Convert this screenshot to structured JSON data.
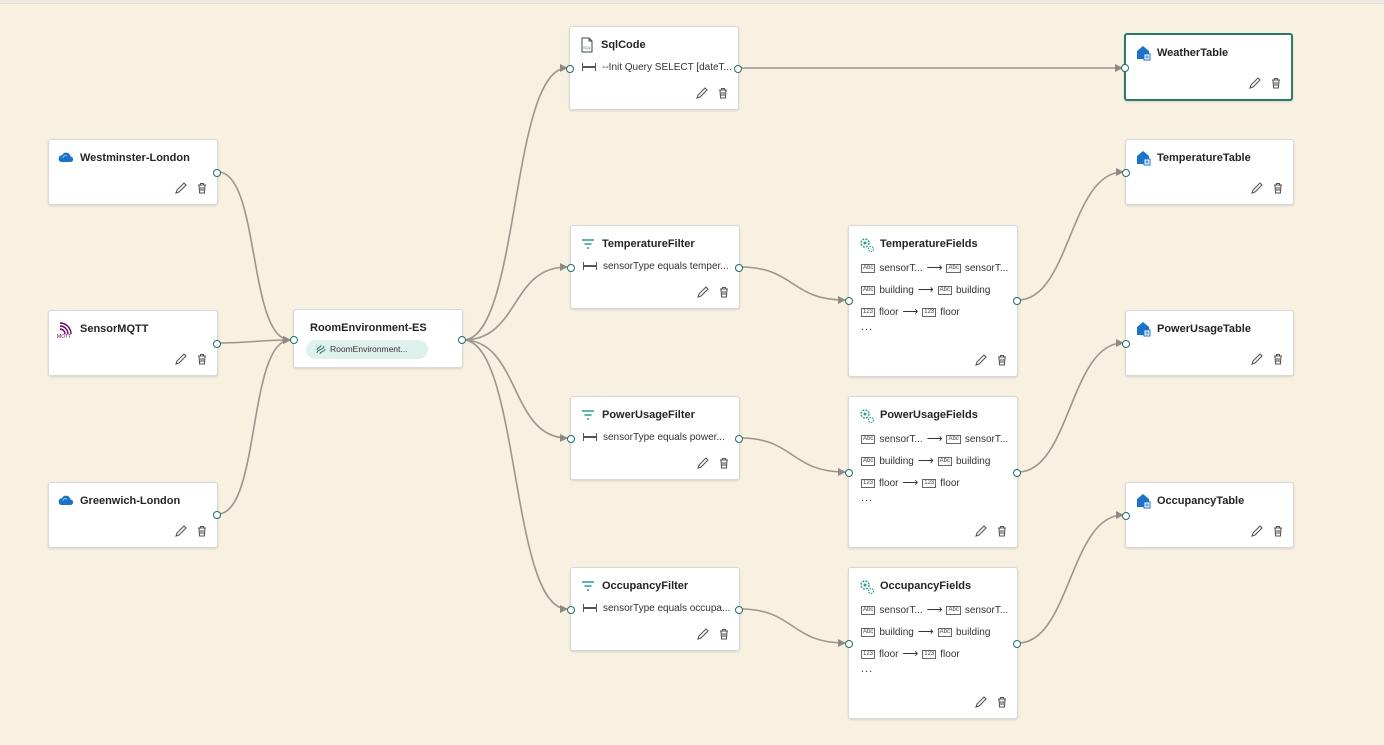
{
  "sources": [
    {
      "title": "Westminster-London",
      "icon": "weather-cloud-icon"
    },
    {
      "title": "SensorMQTT",
      "icon": "mqtt-icon"
    },
    {
      "title": "Greenwich-London",
      "icon": "weather-cloud-icon"
    }
  ],
  "stream": {
    "title": "RoomEnvironment-ES",
    "pill": "RoomEnvironment..."
  },
  "sql": {
    "title": "SqlCode",
    "code": "--Init Query SELECT [dateT..."
  },
  "filters": [
    {
      "title": "TemperatureFilter",
      "condition": "sensorType equals temper..."
    },
    {
      "title": "PowerUsageFilter",
      "condition": "sensorType equals power..."
    },
    {
      "title": "OccupancyFilter",
      "condition": "sensorType equals occupa..."
    }
  ],
  "fields": [
    {
      "title": "TemperatureFields",
      "map1_from": "sensorT...",
      "map1_to": "sensorT...",
      "map2_from": "building",
      "map2_to": "building",
      "map3_from": "floor",
      "map3_to": "floor",
      "more": "..."
    },
    {
      "title": "PowerUsageFields",
      "map1_from": "sensorT...",
      "map1_to": "sensorT...",
      "map2_from": "building",
      "map2_to": "building",
      "map3_from": "floor",
      "map3_to": "floor",
      "more": "..."
    },
    {
      "title": "OccupancyFields",
      "map1_from": "sensorT...",
      "map1_to": "sensorT...",
      "map2_from": "building",
      "map2_to": "building",
      "map3_from": "floor",
      "map3_to": "floor",
      "more": "..."
    }
  ],
  "tables": [
    {
      "title": "WeatherTable",
      "selected": true
    },
    {
      "title": "TemperatureTable"
    },
    {
      "title": "PowerUsageTable"
    },
    {
      "title": "OccupancyTable"
    }
  ],
  "type_badges": {
    "string": "Abc",
    "number": "123"
  },
  "colors": {
    "canvas": "#f8f0e0",
    "port": "#1f6f63",
    "accent": "#2a7a6c",
    "edge": "#8f8a85"
  }
}
